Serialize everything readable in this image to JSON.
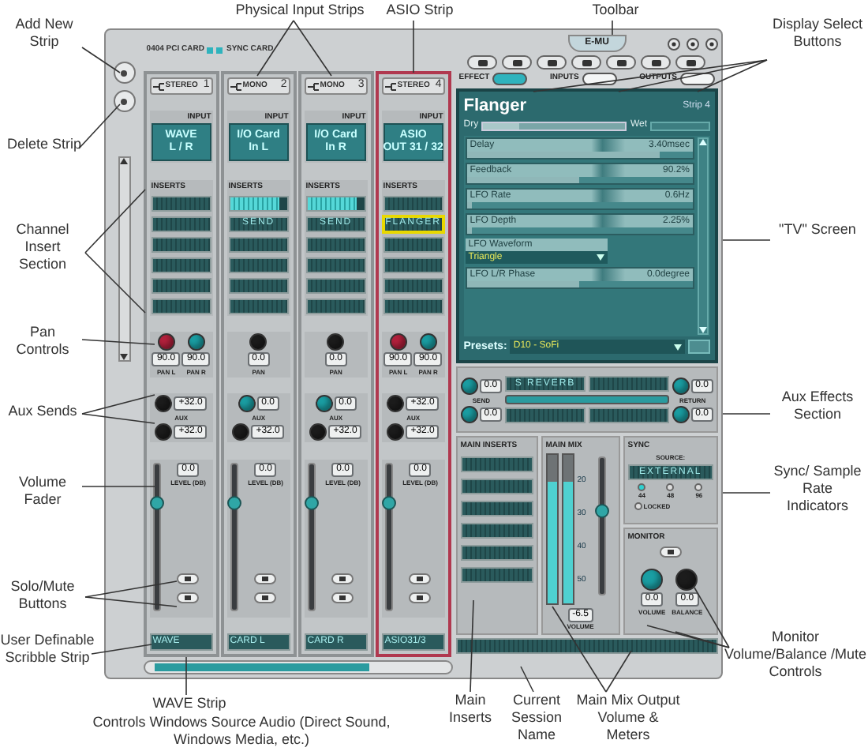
{
  "callouts": [
    {
      "text": "Add New Strip"
    },
    {
      "text": "Delete Strip"
    },
    {
      "text": "Channel Insert Section"
    },
    {
      "text": "Pan Controls"
    },
    {
      "text": "Aux Sends"
    },
    {
      "text": "Volume Fader"
    },
    {
      "text": "Solo/Mute Buttons"
    },
    {
      "text": "User Definable Scribble Strip"
    },
    {
      "text": "Physical Input Strips"
    },
    {
      "text": "ASIO Strip"
    },
    {
      "text": "Toolbar"
    },
    {
      "text": "Display Select Buttons"
    },
    {
      "text": "\"TV\" Screen"
    },
    {
      "text": "Aux Effects Section"
    },
    {
      "text": "Sync/ Sample Rate Indicators"
    },
    {
      "text": "Monitor Volume/Balance /Mute Controls"
    },
    {
      "text": "WAVE Strip"
    },
    {
      "text": "Controls Windows Source Audio (Direct Sound, Windows Media, etc.)"
    },
    {
      "text": "Main Inserts"
    },
    {
      "text": "Current Session Name"
    },
    {
      "text": "Main Mix Output Volume & Meters"
    }
  ],
  "mixer": {
    "card_label": "0404 PCI CARD",
    "sync_label": "SYNC CARD",
    "strips": [
      {
        "type": "STEREO",
        "number": "1",
        "selected": false,
        "input_label": "INPUT",
        "input": [
          "WAVE",
          "L / R"
        ],
        "inserts_label": "INSERTS",
        "inserts": [
          {
            "kind": "slot",
            "selected": false
          },
          {
            "kind": "slot",
            "selected": false
          },
          {
            "kind": "slot",
            "selected": false
          },
          {
            "kind": "slot",
            "selected": false
          },
          {
            "kind": "slot",
            "selected": false
          },
          {
            "kind": "slot",
            "selected": false
          }
        ],
        "pan": [
          {
            "color": "#b3203c",
            "value": "90.0",
            "label": "PAN L"
          },
          {
            "color": "#1a9ea3",
            "value": "90.0",
            "label": "PAN R"
          }
        ],
        "aux_label": "AUX",
        "aux": [
          {
            "color": "#1c1c1c",
            "value": "+32.0"
          },
          {
            "color": "#1c1c1c",
            "value": "+32.0"
          }
        ],
        "level_value": "0.0",
        "level_label": "LEVEL (DB)",
        "fader": {
          "level": 0.72
        },
        "scribble": "WAVE"
      },
      {
        "type": "MONO",
        "number": "2",
        "selected": false,
        "input_label": "INPUT",
        "input": [
          "I/O Card",
          "In L"
        ],
        "inserts_label": "INSERTS",
        "inserts": [
          {
            "kind": "meter",
            "level": 0.88
          },
          {
            "kind": "slot",
            "text": "SEND",
            "selected": false
          },
          {
            "kind": "slot",
            "selected": false
          },
          {
            "kind": "slot",
            "selected": false
          },
          {
            "kind": "slot",
            "selected": false
          },
          {
            "kind": "slot",
            "selected": false
          }
        ],
        "pan": [
          {
            "color": "#1c1c1c",
            "value": "0.0",
            "label": "PAN"
          }
        ],
        "aux_label": "AUX",
        "aux": [
          {
            "color": "#1a9ea3",
            "value": "0.0"
          },
          {
            "color": "#1c1c1c",
            "value": "+32.0"
          }
        ],
        "level_value": "0.0",
        "level_label": "LEVEL (DB)",
        "fader": {
          "level": 0.72
        },
        "scribble": "CARD L"
      },
      {
        "type": "MONO",
        "number": "3",
        "selected": false,
        "input_label": "INPUT",
        "input": [
          "I/O Card",
          "In R"
        ],
        "inserts_label": "INSERTS",
        "inserts": [
          {
            "kind": "meter",
            "level": 0.88
          },
          {
            "kind": "slot",
            "text": "SEND",
            "selected": false
          },
          {
            "kind": "slot",
            "selected": false
          },
          {
            "kind": "slot",
            "selected": false
          },
          {
            "kind": "slot",
            "selected": false
          },
          {
            "kind": "slot",
            "selected": false
          }
        ],
        "pan": [
          {
            "color": "#1c1c1c",
            "value": "0.0",
            "label": "PAN"
          }
        ],
        "aux_label": "AUX",
        "aux": [
          {
            "color": "#1a9ea3",
            "value": "0.0"
          },
          {
            "color": "#1c1c1c",
            "value": "+32.0"
          }
        ],
        "level_value": "0.0",
        "level_label": "LEVEL (DB)",
        "fader": {
          "level": 0.72
        },
        "scribble": "CARD R"
      },
      {
        "type": "STEREO",
        "number": "4",
        "selected": true,
        "input_label": "INPUT",
        "input": [
          "ASIO",
          "OUT 31 / 32"
        ],
        "inserts_label": "INSERTS",
        "inserts": [
          {
            "kind": "slot",
            "selected": false
          },
          {
            "kind": "slot",
            "text": "FLANGER",
            "selected": true
          },
          {
            "kind": "slot",
            "selected": false
          },
          {
            "kind": "slot",
            "selected": false
          },
          {
            "kind": "slot",
            "selected": false
          },
          {
            "kind": "slot",
            "selected": false
          }
        ],
        "pan": [
          {
            "color": "#b3203c",
            "value": "90.0",
            "label": "PAN L"
          },
          {
            "color": "#1a9ea3",
            "value": "90.0",
            "label": "PAN R"
          }
        ],
        "aux_label": "AUX",
        "aux": [
          {
            "color": "#1c1c1c",
            "value": "+32.0"
          },
          {
            "color": "#1c1c1c",
            "value": "+32.0"
          }
        ],
        "level_value": "0.0",
        "level_label": "LEVEL (DB)",
        "fader": {
          "level": 0.72
        },
        "scribble": "ASIO31/3"
      }
    ],
    "toolbar": {
      "logo": "E-MU"
    },
    "display_select": [
      {
        "label": "EFFECT",
        "selected": true
      },
      {
        "label": "INPUTS",
        "selected": false
      },
      {
        "label": "OUTPUTS",
        "selected": false
      }
    ],
    "tv": {
      "title": "Flanger",
      "strip": "Strip 4",
      "dry": "Dry",
      "wet": "Wet",
      "mix": {
        "level": 0.25
      },
      "params": [
        {
          "kind": "slider",
          "name": "Delay",
          "value": "3.40msec",
          "level": 0.85
        },
        {
          "kind": "slider",
          "name": "Feedback",
          "value": "90.2%",
          "level": 0.5
        },
        {
          "kind": "slider",
          "name": "LFO Rate",
          "value": "0.6Hz",
          "level": 0.02
        },
        {
          "kind": "slider",
          "name": "LFO Depth",
          "value": "2.25%",
          "level": 0.02
        },
        {
          "kind": "dropdown",
          "name": "LFO Waveform",
          "value": "Triangle"
        },
        {
          "kind": "slider",
          "name": "LFO L/R Phase",
          "value": "0.0degree",
          "level": 0.5
        }
      ],
      "presets_label": "Presets:",
      "preset": "D10 - SoFi"
    },
    "aux_effects": {
      "send_label": "SEND",
      "return_label": "RETURN",
      "send": [
        {
          "color": "#1a9ea3",
          "value": "0.0"
        },
        {
          "color": "#1a9ea3",
          "value": "0.0"
        }
      ],
      "return": [
        {
          "color": "#1a9ea3",
          "value": "0.0"
        },
        {
          "color": "#1a9ea3",
          "value": "0.0"
        }
      ],
      "slots": [
        {
          "kind": "slot",
          "text": "S REVERB"
        },
        {
          "kind": "slot"
        },
        {
          "kind": "slot"
        },
        {
          "kind": "slot"
        }
      ]
    },
    "main_inserts": {
      "label": "MAIN INSERTS",
      "slots": [
        {
          "kind": "slot"
        },
        {
          "kind": "slot"
        },
        {
          "kind": "slot"
        },
        {
          "kind": "slot"
        },
        {
          "kind": "slot"
        },
        {
          "kind": "slot"
        }
      ]
    },
    "main_mix": {
      "label": "MAIN MIX",
      "meters": [
        {
          "level": 0.82
        },
        {
          "level": 0.82
        }
      ],
      "scale": [
        "20",
        "30",
        "40",
        "50"
      ],
      "volume": "-6.5",
      "volume_label": "VOLUME",
      "fader": {
        "level": 0.6
      }
    },
    "sync": {
      "label": "SYNC",
      "source_label": "SOURCE:",
      "source": "EXTERNAL",
      "rates": [
        {
          "label": "44",
          "selected": true
        },
        {
          "label": "48",
          "selected": false
        },
        {
          "label": "96",
          "selected": false
        }
      ],
      "locked_label": "LOCKED",
      "locked": false
    },
    "monitor": {
      "label": "MONITOR",
      "knobs": [
        {
          "color": "#1a9ea3",
          "value": "0.0",
          "label": "VOLUME"
        },
        {
          "color": "#1c1c1c",
          "value": "0.0",
          "label": "BALANCE"
        }
      ]
    }
  }
}
